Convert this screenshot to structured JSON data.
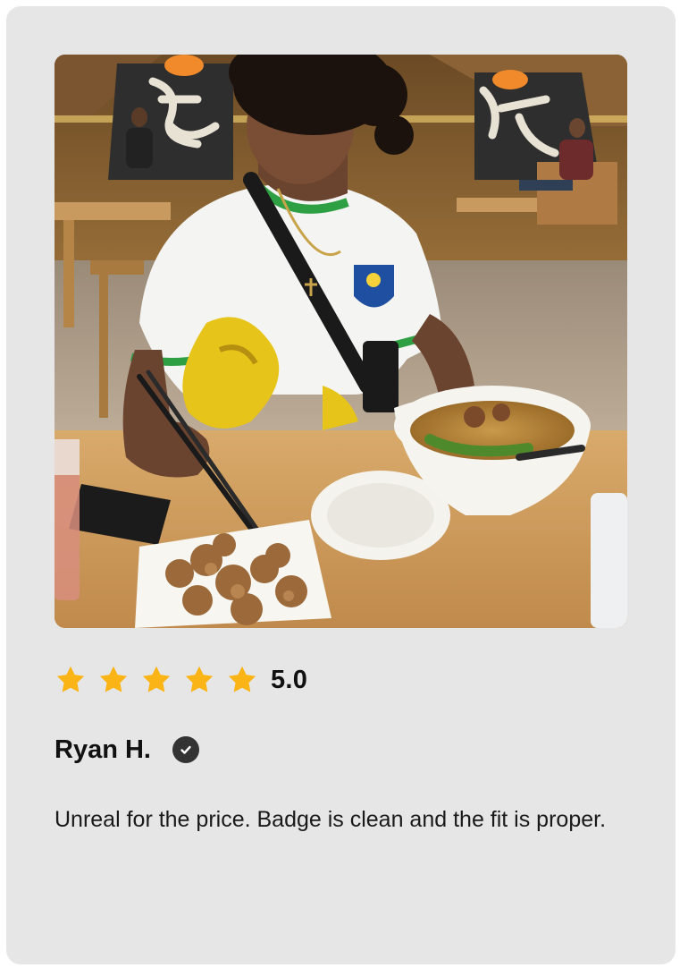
{
  "review": {
    "photo_alt": "Customer photo",
    "rating_stars": 5,
    "rating_label": "5.0",
    "reviewer_name": "Ryan H.",
    "verified_icon": "verified-check-icon",
    "text": "Unreal for the price. Badge is clean and the fit is proper."
  },
  "colors": {
    "card_background": "#e6e6e6",
    "star": "#fbb415",
    "verified_badge": "#333333",
    "text": "#111111"
  }
}
